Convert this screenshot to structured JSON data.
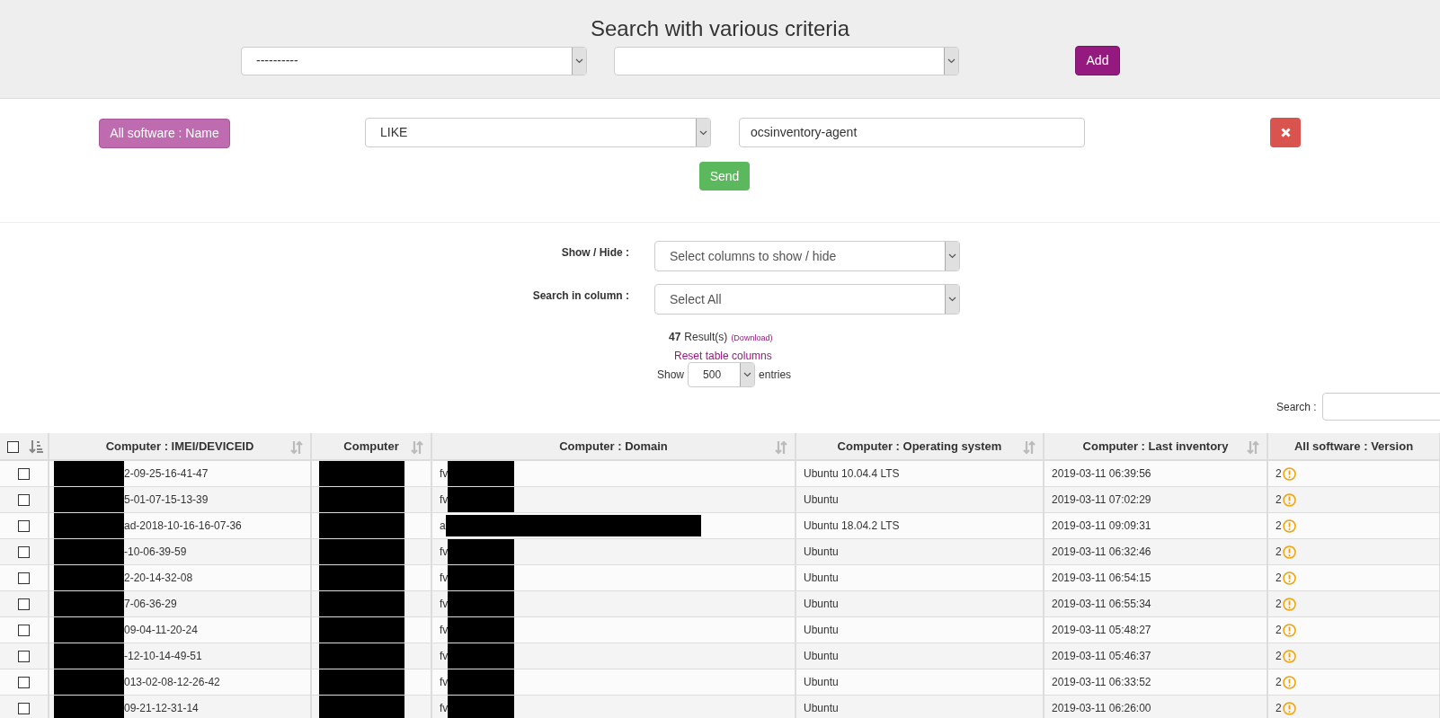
{
  "search_header": {
    "title": "Search with various criteria",
    "criteria_select": "----------",
    "add_button": "Add"
  },
  "criterion": {
    "field": "All software : Name",
    "operator": "LIKE",
    "value": "ocsinventory-agent",
    "send_button": "Send"
  },
  "controls": {
    "show_hide_label": "Show / Hide :",
    "show_hide_select": "Select columns to show / hide",
    "search_column_label": "Search in column :",
    "search_column_select": "Select All",
    "result_count": "47",
    "result_text": "Result(s)",
    "download_link": "(Download)",
    "reset_link": "Reset table columns",
    "show_label": "Show",
    "entries_select": "500",
    "entries_label": "entries",
    "search_label": "Search :"
  },
  "table": {
    "select_all_checked": false,
    "columns": [
      {
        "label": "Computer : IMEI/DEVICEID",
        "sortable": true
      },
      {
        "label": "Computer",
        "sortable": true
      },
      {
        "label": "Computer : Domain",
        "sortable": true
      },
      {
        "label": "Computer : Operating system",
        "sortable": true
      },
      {
        "label": "Computer : Last inventory",
        "sortable": true
      },
      {
        "label": "All software : Version",
        "sortable": false
      }
    ],
    "rows": [
      {
        "checked": false,
        "deviceid": "2-09-25-16-41-47",
        "domain": "fv",
        "os": "Ubuntu 10.04.4 LTS",
        "last_inventory": "2019-03-11 06:39:56",
        "version": "2"
      },
      {
        "checked": false,
        "deviceid": "5-01-07-15-13-39",
        "domain": "fv",
        "os": "Ubuntu",
        "last_inventory": "2019-03-11 07:02:29",
        "version": "2"
      },
      {
        "checked": false,
        "deviceid": "ad-2018-10-16-16-07-36",
        "domain": "a",
        "os": "Ubuntu 18.04.2 LTS",
        "last_inventory": "2019-03-11 09:09:31",
        "version": "2"
      },
      {
        "checked": false,
        "deviceid": "-10-06-39-59",
        "domain": "fv",
        "os": "Ubuntu",
        "last_inventory": "2019-03-11 06:32:46",
        "version": "2"
      },
      {
        "checked": false,
        "deviceid": "2-20-14-32-08",
        "domain": "fv",
        "os": "Ubuntu",
        "last_inventory": "2019-03-11 06:54:15",
        "version": "2"
      },
      {
        "checked": false,
        "deviceid": "7-06-36-29",
        "domain": "fv",
        "os": "Ubuntu",
        "last_inventory": "2019-03-11 06:55:34",
        "version": "2"
      },
      {
        "checked": false,
        "deviceid": "09-04-11-20-24",
        "domain": "fv",
        "os": "Ubuntu",
        "last_inventory": "2019-03-11 05:48:27",
        "version": "2"
      },
      {
        "checked": false,
        "deviceid": "-12-10-14-49-51",
        "domain": "fv",
        "os": "Ubuntu",
        "last_inventory": "2019-03-11 05:46:37",
        "version": "2"
      },
      {
        "checked": false,
        "deviceid": "013-02-08-12-26-42",
        "domain": "fv",
        "os": "Ubuntu",
        "last_inventory": "2019-03-11 06:33:52",
        "version": "2"
      },
      {
        "checked": false,
        "deviceid": "09-21-12-31-14",
        "domain": "fv",
        "os": "Ubuntu",
        "last_inventory": "2019-03-11 06:26:00",
        "version": "2"
      }
    ]
  }
}
